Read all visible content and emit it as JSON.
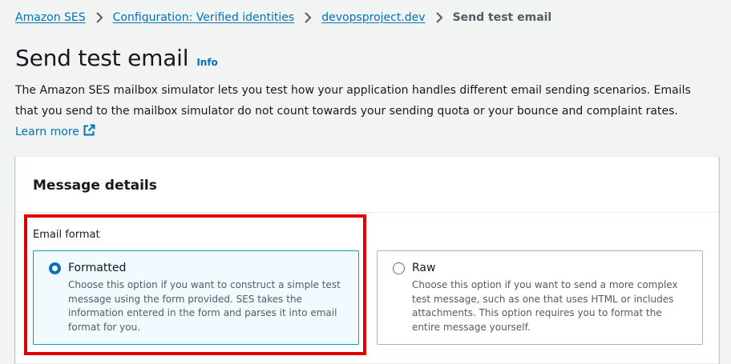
{
  "breadcrumb": {
    "items": [
      {
        "label": "Amazon SES"
      },
      {
        "label": "Configuration: Verified identities"
      },
      {
        "label": "devopsproject.dev"
      }
    ],
    "current": "Send test email"
  },
  "page": {
    "title": "Send test email",
    "info_label": "Info",
    "description": "The Amazon SES mailbox simulator lets you test how your application handles different email sending scenarios. Emails that you send to the mailbox simulator do not count towards your sending quota or your bounce and complaint rates. ",
    "learn_more": "Learn more"
  },
  "panel": {
    "title": "Message details",
    "email_format_label": "Email format",
    "options": [
      {
        "label": "Formatted",
        "description": "Choose this option if you want to construct a simple test message using the form provided. SES takes the information entered in the form and parses it into email format for you.",
        "selected": true
      },
      {
        "label": "Raw",
        "description": "Choose this option if you want to send a more complex test message, such as one that uses HTML or includes attachments. This option requires you to format the entire message yourself.",
        "selected": false
      }
    ]
  },
  "colors": {
    "link": "#0073bb",
    "highlight": "#e00000",
    "selected_border": "#00a1c9",
    "selected_bg": "#f1faff"
  },
  "icons": {
    "breadcrumb_separator": "chevron-right-icon",
    "external_link": "external-link-icon"
  }
}
